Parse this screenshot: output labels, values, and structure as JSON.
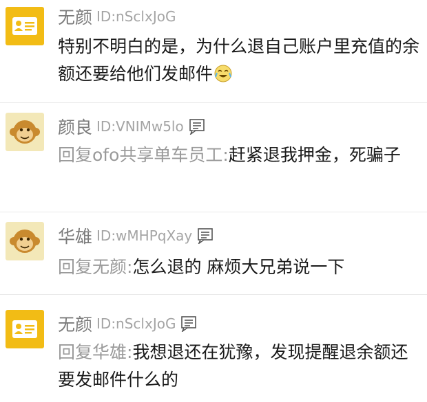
{
  "comments": [
    {
      "username": "无颜",
      "user_id": "ID:nSclxJoG",
      "avatar": "card-icon",
      "text": "特别不明白的是，为什么退自己账户里充值的余额还要给他们发邮件",
      "emoji": "crying-laughing-emoji"
    },
    {
      "username": "颜良",
      "user_id": "ID:VNIMw5lo",
      "avatar": "monkey-icon",
      "reply_prefix": "回复ofo共享单车员工:",
      "text": "赶紧退我押金，死骗子"
    },
    {
      "username": "华雄",
      "user_id": "ID:wMHPqXay",
      "avatar": "monkey-icon",
      "reply_prefix": "回复无颜:",
      "text": "怎么退的 麻烦大兄弟说一下"
    },
    {
      "username": "无颜",
      "user_id": "ID:nSclxJoG",
      "avatar": "card-icon",
      "reply_prefix": "回复华雄:",
      "text": "我想退还在犹豫，发现提醒退余额还要发邮件什么的"
    }
  ],
  "colors": {
    "card_avatar_bg": "#f2bc15",
    "monkey_avatar_bg": "#f3e8b8",
    "username": "#7b7b7b",
    "reply_prefix": "#9a9a9a",
    "body_text": "#1a1a1a"
  }
}
